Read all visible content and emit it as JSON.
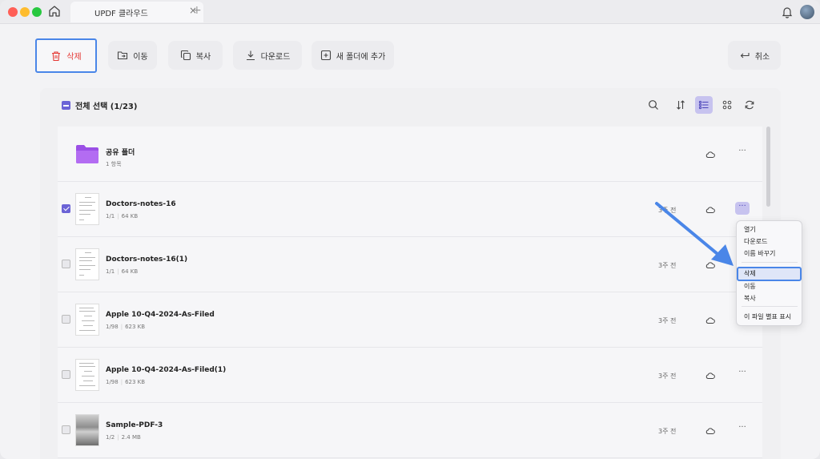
{
  "titlebar": {
    "tab_title": "UPDF 클라우드",
    "tab_close": "×",
    "tab_add": "+"
  },
  "toolbar": {
    "delete_label": "삭제",
    "move_label": "이동",
    "copy_label": "복사",
    "download_label": "다운로드",
    "add_folder_label": "새 폴더에 추가",
    "cancel_label": "취소"
  },
  "list": {
    "select_all_label": "전체 선택 (1/23)",
    "rows": [
      {
        "name": "공유 폴더",
        "pages": "1 항목",
        "size": "",
        "time": "",
        "checked": false,
        "type": "folder"
      },
      {
        "name": "Doctors-notes-16",
        "pages": "1/1",
        "size": "64 KB",
        "time": "3주 전",
        "checked": true,
        "type": "doc"
      },
      {
        "name": "Doctors-notes-16(1)",
        "pages": "1/1",
        "size": "64 KB",
        "time": "3주 전",
        "checked": false,
        "type": "doc"
      },
      {
        "name": "Apple 10-Q4-2024-As-Filed",
        "pages": "1/98",
        "size": "623 KB",
        "time": "3주 전",
        "checked": false,
        "type": "doc"
      },
      {
        "name": "Apple 10-Q4-2024-As-Filed(1)",
        "pages": "1/98",
        "size": "623 KB",
        "time": "3주 전",
        "checked": false,
        "type": "doc"
      },
      {
        "name": "Sample-PDF-3",
        "pages": "1/2",
        "size": "2.4 MB",
        "time": "3주 전",
        "checked": false,
        "type": "photo"
      }
    ],
    "more_label": "···"
  },
  "context_menu": {
    "items": [
      "열기",
      "다운로드",
      "이름 바꾸기",
      "삭제",
      "이동",
      "복사",
      "이 파일 별표 표시"
    ],
    "highlighted": "삭제"
  },
  "colors": {
    "accent": "#6b63d6",
    "highlight_border": "#4a86e8",
    "delete_red": "#e53935",
    "folder_purple": "#9b4fe6"
  }
}
